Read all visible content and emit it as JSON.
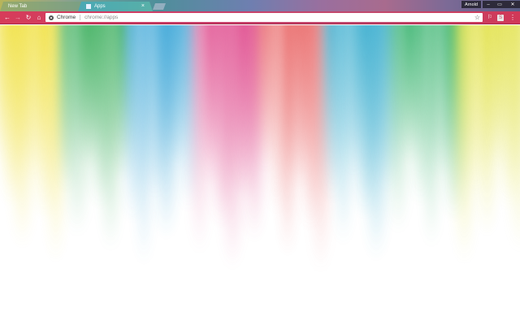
{
  "tabs": [
    {
      "label": "New Tab",
      "active": false
    },
    {
      "label": "Apps",
      "active": true,
      "favicon": "apps-grid-icon",
      "close_label": "×"
    }
  ],
  "window": {
    "profile_label": "Arnold",
    "minimize_label": "–",
    "maximize_label": "▭",
    "close_label": "✕"
  },
  "toolbar": {
    "back_label": "←",
    "forward_label": "→",
    "reload_label": "↻",
    "home_label": "⌂",
    "omnibox": {
      "site_chip": "Chrome",
      "url": "chrome://apps",
      "star": "☆"
    },
    "extensions": [
      {
        "icon": "extension-icon",
        "glyph": "⚐"
      },
      {
        "icon": "extension-s-icon",
        "glyph": "S"
      }
    ],
    "menu_label": "⋮"
  },
  "theme": {
    "toolbar_color": "#d03858",
    "aurora_colors": [
      "#f0e040",
      "#40b060",
      "#40a8d8",
      "#e05090",
      "#e86060",
      "#40b0d0",
      "#30b068",
      "#e0e040"
    ]
  }
}
